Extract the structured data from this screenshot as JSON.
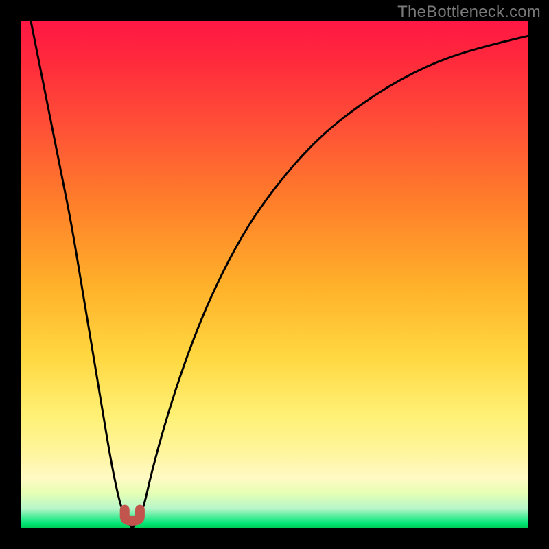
{
  "watermark": "TheBottleneck.com",
  "colors": {
    "background_frame": "#000000",
    "gradient_top": "#ff1744",
    "gradient_bottom": "#00c853",
    "curve_stroke": "#000000",
    "marker_stroke": "#c1554d"
  },
  "chart_data": {
    "type": "line",
    "title": "",
    "xlabel": "",
    "ylabel": "",
    "xlim": [
      0,
      100
    ],
    "ylim": [
      0,
      100
    ],
    "grid": false,
    "series": [
      {
        "name": "bottleneck-curve",
        "x": [
          2,
          4,
          6,
          8,
          10,
          12,
          14,
          16,
          18,
          20,
          22,
          24,
          26,
          30,
          35,
          40,
          45,
          50,
          55,
          60,
          65,
          70,
          75,
          80,
          85,
          90,
          95,
          100
        ],
        "values": [
          100,
          90,
          80,
          70,
          60,
          48,
          36,
          24,
          12,
          3,
          0,
          3,
          12,
          26,
          40,
          51,
          60,
          67,
          73,
          78,
          82,
          85.5,
          88.5,
          91,
          93,
          94.5,
          95.8,
          97
        ]
      }
    ],
    "annotations": [
      {
        "name": "optimal-marker",
        "shape": "u",
        "x_range": [
          20.5,
          23.5
        ],
        "y": 1.5
      }
    ],
    "optimal_x": 22
  }
}
